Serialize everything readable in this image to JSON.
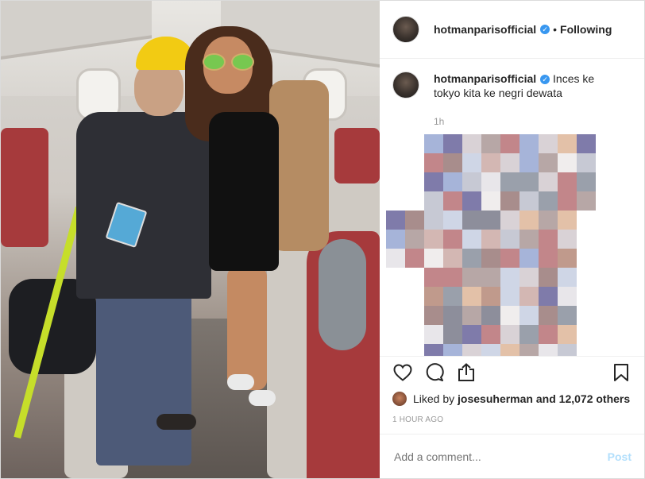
{
  "post": {
    "username": "hotmanparisofficial",
    "separator": "•",
    "follow_label": "Following",
    "caption": "Inces ke tokyo kita ke negri dewata",
    "caption_time": "1h",
    "likes": {
      "prefix": "Liked by",
      "liker": "josesuherman",
      "suffix": "and 12,072 others"
    },
    "posted_ago": "1 HOUR AGO",
    "comment_placeholder": "Add a comment...",
    "post_label": "Post"
  },
  "colors": {
    "accent_blue": "#3897f0",
    "post_disabled": "#b2dffc",
    "muted_text": "#999999",
    "border": "#efefef"
  },
  "icons": [
    "verified-icon",
    "heart-icon",
    "comment-icon",
    "share-icon",
    "bookmark-icon"
  ]
}
